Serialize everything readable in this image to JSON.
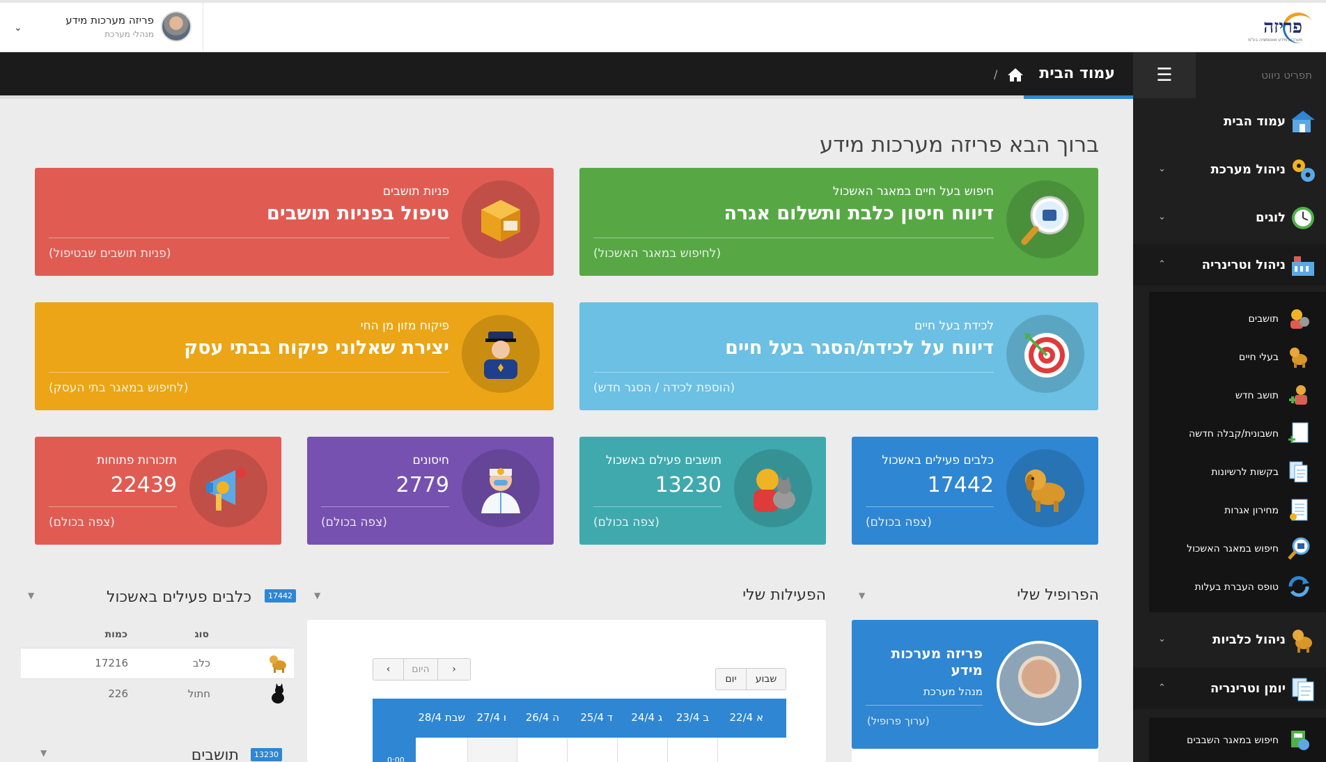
{
  "header": {
    "user_name": "פריזה מערכות מידע",
    "user_role": "מנהלי מערכת",
    "logo_text": "פריזה",
    "logo_tagline": "מערכות מידע ואוטומציה בע\"מ"
  },
  "breadcrumb": {
    "title": "עמוד הבית",
    "separator": "/"
  },
  "sidebar": {
    "title": "תפריט ניווט",
    "items": [
      {
        "label": "עמוד הבית",
        "icon": "house-icon"
      },
      {
        "label": "ניהול מערכת",
        "icon": "gears-icon"
      },
      {
        "label": "לוגים",
        "icon": "clock-icon"
      },
      {
        "label": "ניהול וטרינריה",
        "icon": "building-icon"
      },
      {
        "label": "ניהול כלביות",
        "icon": "dog-icon"
      },
      {
        "label": "יומן וטרינריה",
        "icon": "documents-icon"
      }
    ],
    "vet_sub": [
      {
        "label": "תושבים",
        "icon": "resident-icon"
      },
      {
        "label": "בעלי חיים",
        "icon": "dog-icon"
      },
      {
        "label": "תושב חדש",
        "icon": "add-user-icon"
      },
      {
        "label": "חשבונית/קבלה חדשה",
        "icon": "new-document-icon"
      },
      {
        "label": "בקשות לרשיונות",
        "icon": "documents-icon"
      },
      {
        "label": "מחירון אגרות",
        "icon": "price-list-icon"
      },
      {
        "label": "חיפוש במאגר האשכול",
        "icon": "search-chip-icon"
      },
      {
        "label": "טופס העברת בעלות",
        "icon": "refresh-icon"
      }
    ],
    "journal_sub": [
      {
        "label": "חיפוש במאגר השבבים",
        "icon": "chip-search-icon"
      }
    ]
  },
  "main": {
    "welcome": "ברוך הבא פריזה מערכות מידע",
    "big_cards": [
      {
        "sub": "חיפוש בעל חיים במאגר האשכול",
        "title": "דיווח חיסון כלבת ותשלום אגרה",
        "link": "(לחיפוש במאגר האשכול)",
        "color": "#57a845"
      },
      {
        "sub": "פניות תושבים",
        "title": "טיפול בפניות תושבים",
        "link": "(פניות תושבים שבטיפול)",
        "color": "#e05c53"
      },
      {
        "sub": "לכידת בעל חיים",
        "title": "דיווח על לכידת/הסגר בעל חיים",
        "link": "(הוספת לכידה / הסגר חדש)",
        "color": "#6bc0e3"
      },
      {
        "sub": "פיקוח מזון מן החי",
        "title": "יצירת שאלוני פיקוח בבתי עסק",
        "link": "(לחיפוש במאגר בתי העסק)",
        "color": "#eba516"
      }
    ],
    "small_cards": [
      {
        "sub": "כלבים פעילים באשכול",
        "value": "17442",
        "link": "(צפה בכולם)",
        "color": "#2f86d2"
      },
      {
        "sub": "תושבים פעילם באשכול",
        "value": "13230",
        "link": "(צפה בכולם)",
        "color": "#3fa9ae"
      },
      {
        "sub": "חיסונים",
        "value": "2779",
        "link": "(צפה בכולם)",
        "color": "#7651b0"
      },
      {
        "sub": "תזכורות פתוחות",
        "value": "22439",
        "link": "(צפה בכולם)",
        "color": "#e05c53"
      }
    ]
  },
  "profile": {
    "section_title": "הפרופיל שלי",
    "name": "פריזה מערכות מידע",
    "role": "מנהל מערכת",
    "edit": "(ערוך פרופיל)"
  },
  "activities": {
    "section_title": "הפעילות שלי",
    "btn_week": "שבוע",
    "btn_day": "יום",
    "btn_today": "היום",
    "days": [
      "א 22/4",
      "ב 23/4",
      "ג 24/4",
      "ד 25/4",
      "ה 26/4",
      "ו 27/4",
      "שבת 28/4"
    ],
    "time": "0:00"
  },
  "dogs": {
    "section_title": "כלבים פעילים באשכול",
    "badge": "17442",
    "col_type": "סוג",
    "col_count": "כמות",
    "rows": [
      {
        "type": "כלב",
        "count": "17216",
        "icon": "dog-icon"
      },
      {
        "type": "חתול",
        "count": "226",
        "icon": "cat-icon"
      }
    ]
  },
  "residents": {
    "section_title": "תושבים",
    "badge": "13230"
  }
}
